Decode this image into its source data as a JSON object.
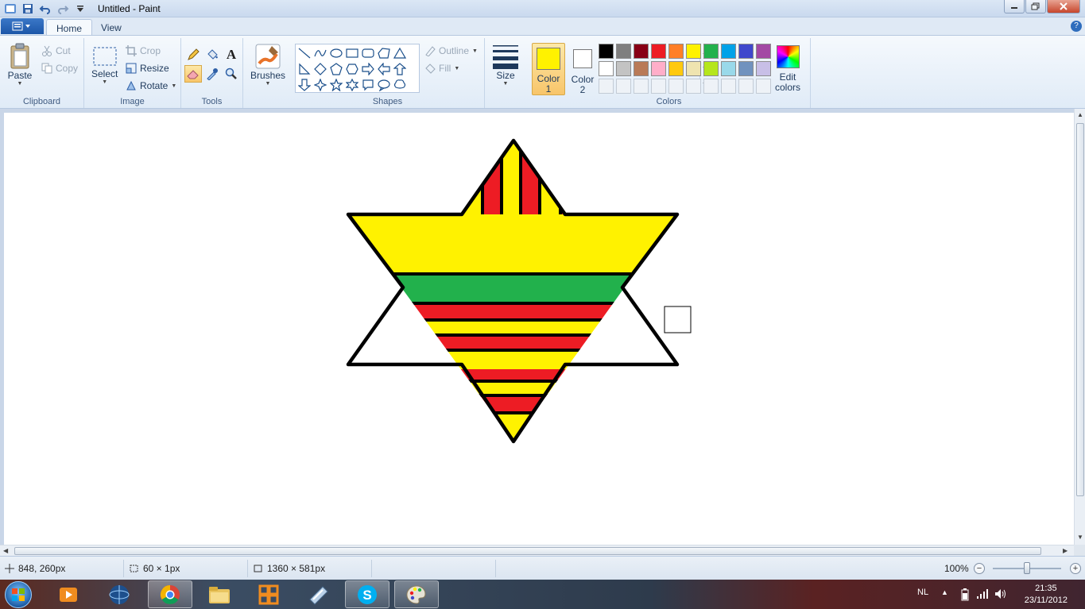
{
  "window": {
    "title": "Untitled - Paint"
  },
  "tabs": [
    {
      "label": "Home",
      "active": true
    },
    {
      "label": "View",
      "active": false
    }
  ],
  "ribbon": {
    "clipboard": {
      "group_label": "Clipboard",
      "paste": "Paste",
      "cut": "Cut",
      "copy": "Copy"
    },
    "image": {
      "group_label": "Image",
      "select": "Select",
      "crop": "Crop",
      "resize": "Resize",
      "rotate": "Rotate"
    },
    "tools": {
      "group_label": "Tools",
      "items": [
        "pencil-icon",
        "fill-icon",
        "text-icon",
        "eraser-icon",
        "color-picker-icon",
        "magnifier-icon"
      ],
      "selected": "eraser-icon"
    },
    "brushes": {
      "label": "Brushes"
    },
    "shapes": {
      "group_label": "Shapes",
      "outline": "Outline",
      "fill": "Fill"
    },
    "size": {
      "label": "Size"
    },
    "colors": {
      "group_label": "Colors",
      "color1_label": "Color",
      "color1_num": "1",
      "color2_label": "Color",
      "color2_num": "2",
      "color1": "#fff200",
      "color2": "#ffffff",
      "edit_label": "Edit",
      "edit_label2": "colors",
      "palette_row1": [
        "#000000",
        "#7f7f7f",
        "#880015",
        "#ed1c24",
        "#ff7f27",
        "#fff200",
        "#22b14c",
        "#00a2e8",
        "#3f48cc",
        "#a349a4"
      ],
      "palette_row2": [
        "#ffffff",
        "#c3c3c3",
        "#b97a57",
        "#ffaec9",
        "#ffc90e",
        "#efe4b0",
        "#b5e61d",
        "#99d9ea",
        "#7092be",
        "#c8bfe7"
      ]
    }
  },
  "drawing": {
    "colors": {
      "red": "#ed1c24",
      "yellow": "#fff200",
      "green": "#22b14c",
      "outline": "#000000"
    }
  },
  "status": {
    "cursor": "848, 260px",
    "selection": "60 × 1px",
    "canvas_size": "1360 × 581px",
    "zoom": "100%"
  },
  "taskbar": {
    "language": "NL",
    "time": "21:35",
    "date": "23/11/2012"
  }
}
